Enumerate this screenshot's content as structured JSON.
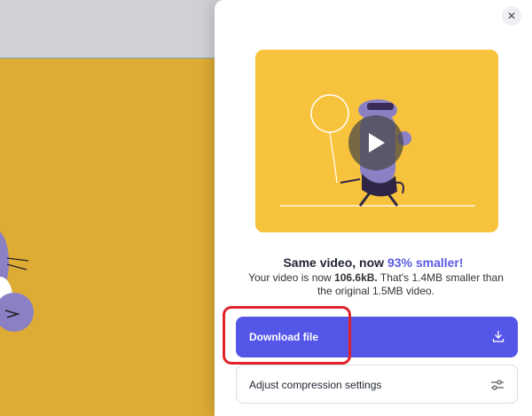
{
  "panel": {
    "close_icon": "close-icon",
    "headline_prefix": "Same video, now ",
    "headline_accent": "93% smaller!",
    "accent_color": "#5b5be6",
    "sub_line1_prefix": "Your video is now ",
    "sub_size": "106.6kB.",
    "sub_line1_suffix": " That's 1.4MB smaller than",
    "sub_line2": "the original 1.5MB video.",
    "download_label": "Download file",
    "download_icon": "download-icon",
    "download_color": "#5456e8",
    "adjust_label": "Adjust compression settings",
    "adjust_icon": "sliders-icon",
    "play_icon": "play-icon"
  }
}
